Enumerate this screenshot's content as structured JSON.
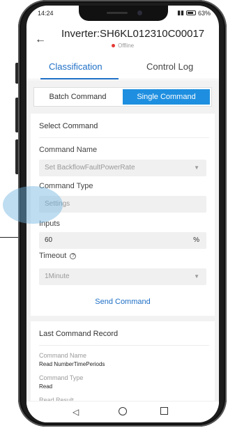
{
  "status_bar": {
    "time": "14:24",
    "battery": "63%"
  },
  "header": {
    "title": "Inverter:SH6KL012310C00017",
    "status": "Offline",
    "status_color": "#e53935"
  },
  "tabs": [
    {
      "label": "Classification"
    },
    {
      "label": "Control Log"
    }
  ],
  "accent_color": "#1e6fc6",
  "segmented": {
    "batch": "Batch Command",
    "single": "Single Command"
  },
  "command_card": {
    "title": "Select Command",
    "command_name_label": "Command Name",
    "command_name_value": "Set BackflowFaultPowerRate",
    "command_type_label": "Command Type",
    "command_type_value": "Settings",
    "inputs_label": "Inputs",
    "inputs_value": "60",
    "inputs_unit": "%",
    "timeout_label": "Timeout",
    "timeout_value": "1Minute",
    "send_label": "Send Command"
  },
  "last_record": {
    "title": "Last Command Record",
    "command_name_label": "Command Name",
    "command_name_value": "Read NumberTimePeriods",
    "command_type_label": "Command Type",
    "command_type_value": "Read",
    "read_result_label": "Read Result"
  },
  "icons": {
    "back": "arrow-left-icon",
    "help": "question-circle-icon",
    "chevron": "chevron-down-icon",
    "nav_back": "triangle-back-icon",
    "nav_home": "circle-home-icon",
    "nav_recent": "square-recent-icon"
  }
}
